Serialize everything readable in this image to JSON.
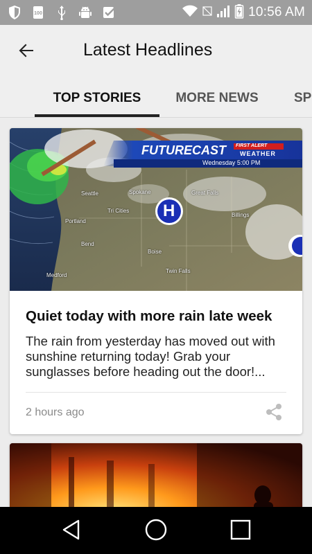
{
  "status_bar": {
    "time": "10:56 AM",
    "icons": [
      "shield-icon",
      "hundred-badge-icon",
      "usb-icon",
      "android-icon",
      "checkbox-icon",
      "wifi-icon",
      "no-data-icon",
      "signal-icon",
      "battery-charging-icon"
    ]
  },
  "app_bar": {
    "title": "Latest Headlines",
    "back_icon": "arrow-back-icon"
  },
  "tabs": [
    {
      "label": "TOP STORIES",
      "active": true
    },
    {
      "label": "MORE NEWS",
      "active": false
    },
    {
      "label": "SP",
      "active": false
    }
  ],
  "cards": [
    {
      "image": {
        "banner_title": "FUTURECAST",
        "banner_badge_top": "FIRST ALERT",
        "banner_badge_bottom": "WEATHER",
        "banner_subtitle": "Wednesday 5:00 PM",
        "high_pressure": "H",
        "cities": [
          "Seattle",
          "Spokane",
          "Great Falls",
          "Tri Cities",
          "Portland",
          "Billings",
          "Bend",
          "Boise",
          "Twin Falls",
          "Medford"
        ]
      },
      "title": "Quiet today with more rain late week",
      "summary": "The rain from yesterday has moved out with sunshine returning today! Grab your sunglasses before heading out the door!...",
      "time": "2 hours ago",
      "share_icon": "share-icon"
    }
  ],
  "nav_bar": {
    "icons": [
      "back-triangle-icon",
      "home-circle-icon",
      "recents-square-icon"
    ]
  },
  "colors": {
    "status_bar": "#9e9e9e",
    "app_bar": "#efefef",
    "background": "#ececec",
    "nav_bar": "#000000",
    "forecast_banner": "#1a3fa8",
    "high_pressure": "#1a2fb5"
  }
}
